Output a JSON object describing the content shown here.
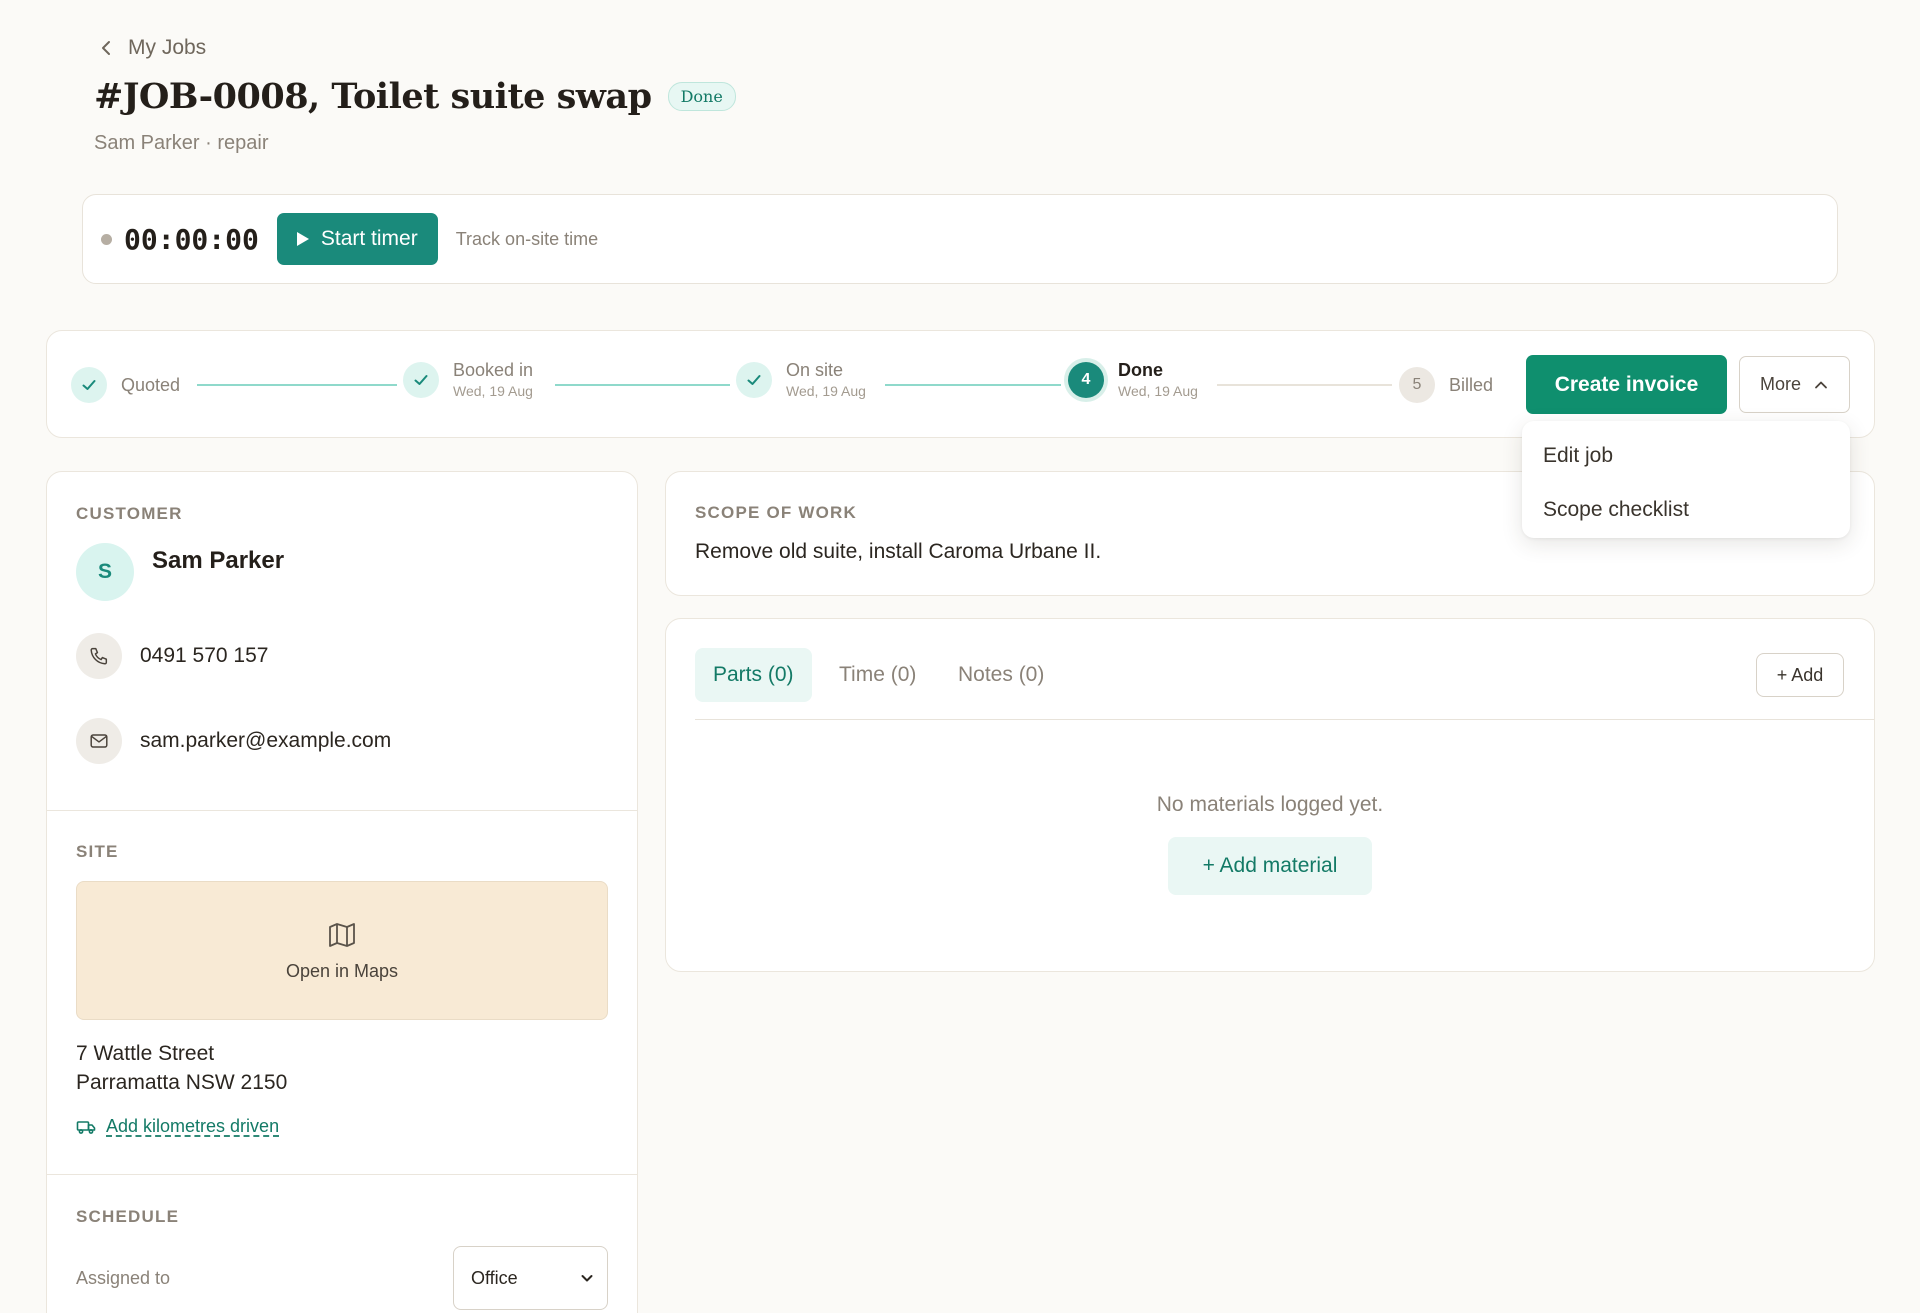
{
  "header": {
    "back_label": "My Jobs",
    "title": "#JOB-0008, Toilet suite swap",
    "status": "Done",
    "subtitle": "Sam Parker · repair"
  },
  "timer": {
    "display": "00:00:00",
    "start_label": "Start timer",
    "hint": "Track on-site time"
  },
  "stepper": {
    "steps": [
      {
        "label": "Quoted",
        "date": "",
        "state": "done"
      },
      {
        "label": "Booked in",
        "date": "Wed, 19 Aug",
        "state": "done"
      },
      {
        "label": "On site",
        "date": "Wed, 19 Aug",
        "state": "done"
      },
      {
        "label": "Done",
        "date": "Wed, 19 Aug",
        "state": "current",
        "number": "4"
      },
      {
        "label": "Billed",
        "date": "",
        "state": "pending",
        "number": "5"
      }
    ],
    "create_invoice_label": "Create invoice",
    "more_label": "More"
  },
  "more_menu": {
    "items": [
      "Edit job",
      "Scope checklist"
    ]
  },
  "customer": {
    "section_label": "CUSTOMER",
    "initial": "S",
    "name": "Sam Parker",
    "phone": "0491 570 157",
    "email": "sam.parker@example.com"
  },
  "site": {
    "section_label": "SITE",
    "map_label": "Open in Maps",
    "address_line1": "7 Wattle Street",
    "address_line2": "Parramatta NSW 2150",
    "km_link": "Add kilometres driven"
  },
  "schedule": {
    "section_label": "SCHEDULE",
    "assigned_label": "Assigned to",
    "assigned_value": "Office"
  },
  "scope": {
    "section_label": "SCOPE OF WORK",
    "text": "Remove old suite, install Caroma Urbane II."
  },
  "materials": {
    "tabs": [
      "Parts (0)",
      "Time (0)",
      "Notes (0)"
    ],
    "add_label": "+ Add",
    "empty_text": "No materials logged yet.",
    "add_material_label": "+ Add material"
  },
  "colors": {
    "accent": "#1a8a7b",
    "invoice_button": "#0f8f6e",
    "background": "#fbfaf7",
    "map_placeholder": "#f8ead5"
  }
}
